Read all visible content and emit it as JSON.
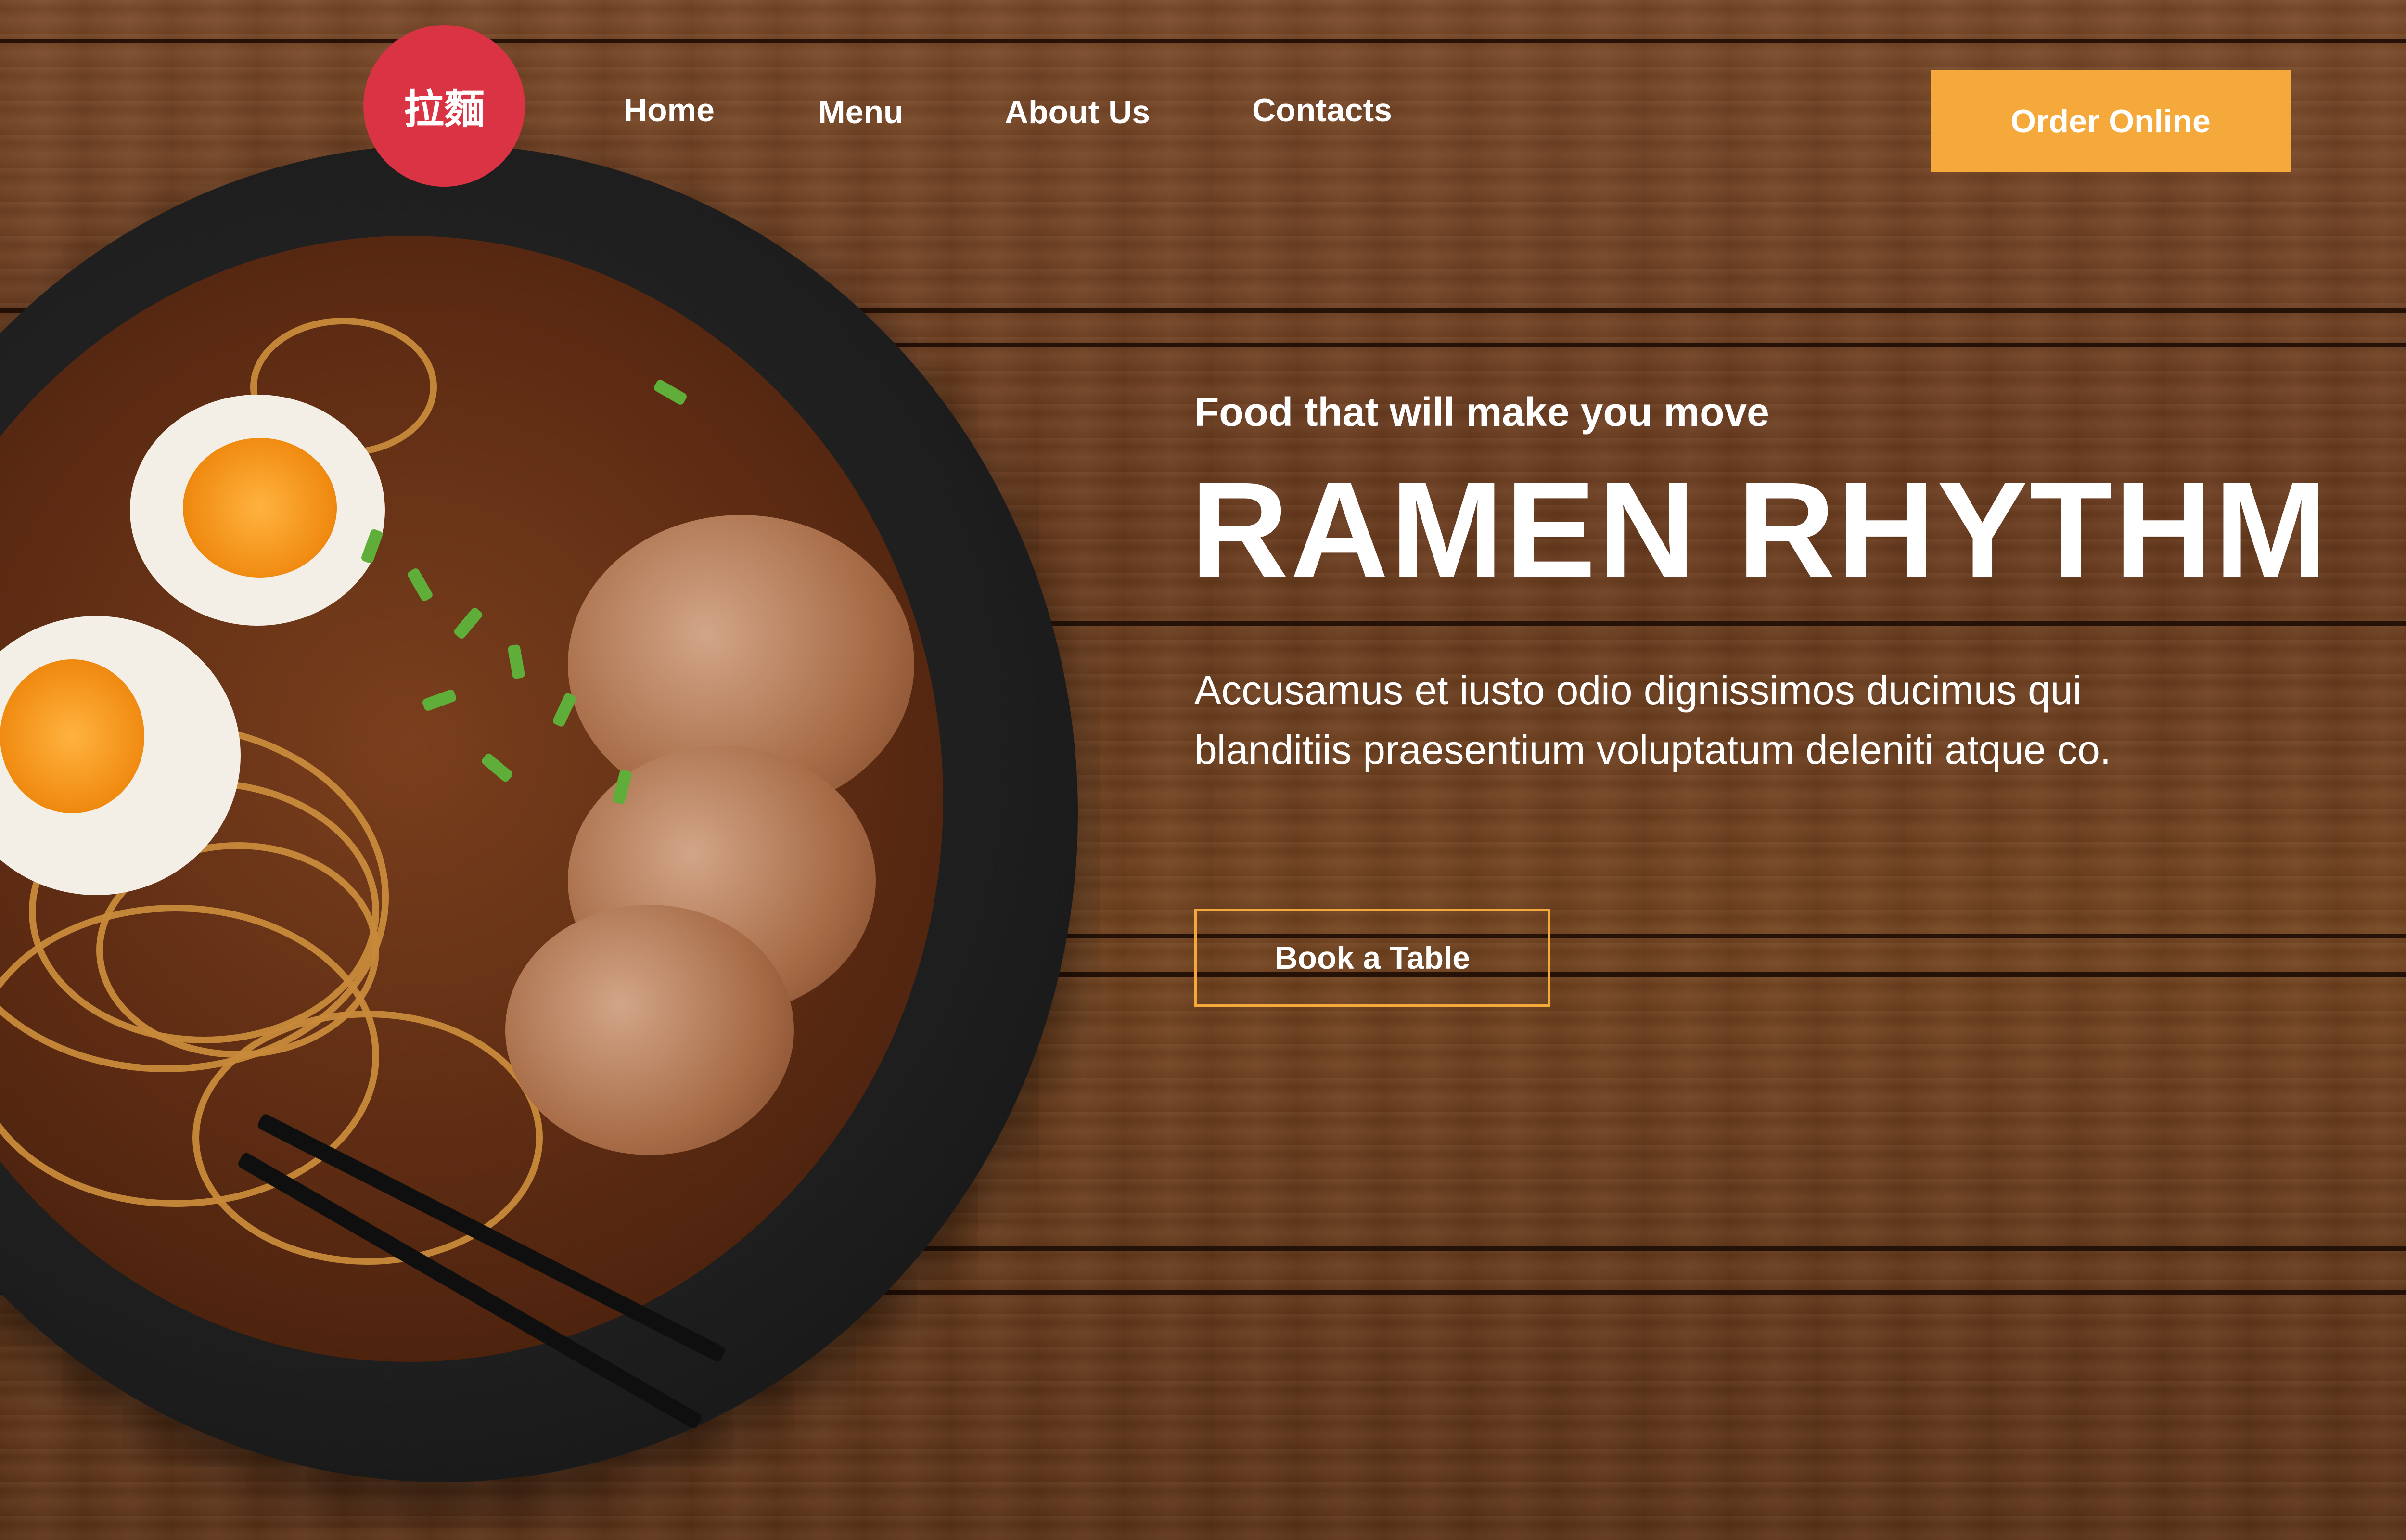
{
  "brand": {
    "logo_text": "拉麵",
    "logo_color": "#d93344"
  },
  "nav": {
    "items": [
      {
        "label": "Home"
      },
      {
        "label": "Menu"
      },
      {
        "label": "About Us"
      },
      {
        "label": "Contacts"
      }
    ]
  },
  "header": {
    "order_button_label": "Order Online",
    "accent_color": "#f6a93b"
  },
  "hero": {
    "tagline": "Food that will make you move",
    "title": "RAMEN RHYTHM",
    "description": "Accusamus et iusto odio dignissimos ducimus qui blanditiis praesentium voluptatum deleniti atque co.",
    "book_button_label": "Book a Table"
  }
}
